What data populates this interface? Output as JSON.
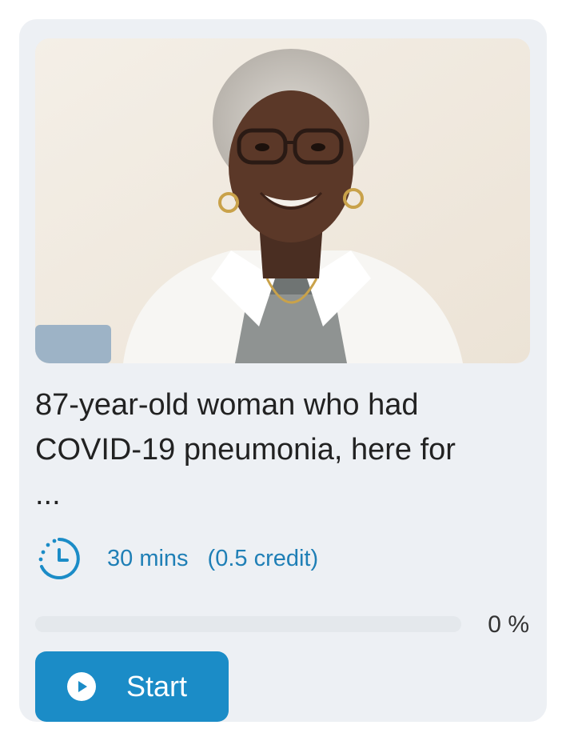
{
  "card": {
    "image_alt": "Portrait of a smiling elderly woman with white hair and glasses",
    "title": "87-year-old woman who had COVID-19 pneumonia, here for",
    "title_ellipsis": "...",
    "duration": "30 mins",
    "credit": "(0.5 credit)",
    "progress": {
      "value_percent": 0,
      "label": "0 %"
    },
    "start_button": {
      "label": "Start",
      "icon": "play-icon"
    },
    "icons": {
      "duration": "clock-icon"
    },
    "colors": {
      "accent": "#1b8cc7",
      "card_bg": "#edf0f4",
      "meta_text": "#1f7fb6",
      "title_text": "#222222"
    }
  }
}
